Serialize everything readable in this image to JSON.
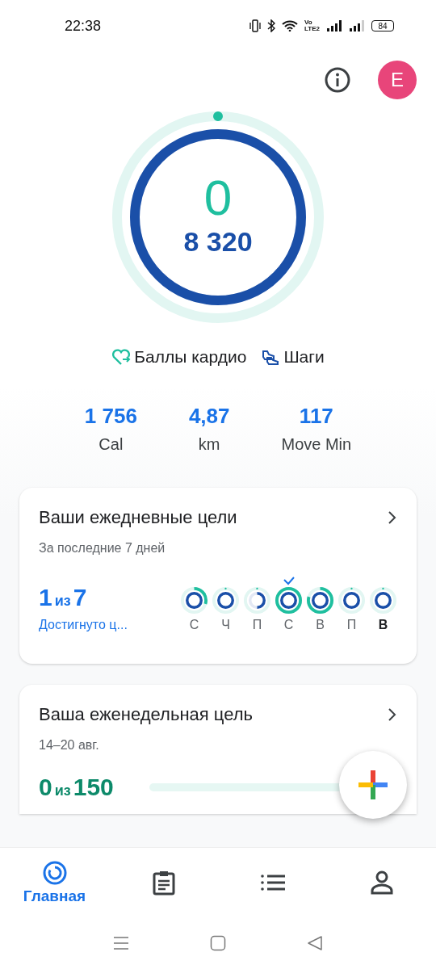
{
  "status_bar": {
    "time": "22:38",
    "volte": [
      "Vo",
      "LTE2"
    ],
    "battery": "84"
  },
  "header": {
    "avatar": "E"
  },
  "rings": {
    "cardio": {
      "value": "0",
      "level": 0
    },
    "steps": {
      "value": "8 320",
      "level": 1
    }
  },
  "legend": [
    {
      "kind": "cardio",
      "label": "Баллы кардио"
    },
    {
      "kind": "steps",
      "label": "Шаги"
    }
  ],
  "stats": [
    {
      "value": "1 756",
      "label": "Cal"
    },
    {
      "value": "4,87",
      "label": "km"
    },
    {
      "value": "117",
      "label": "Move Min"
    }
  ],
  "daily_card": {
    "title": "Ваши ежедневные цели",
    "subtitle": "За последние 7 дней",
    "count": "1",
    "of": "из",
    "total": "7",
    "caption": "Достигнуто ц...",
    "days": [
      {
        "label": "С",
        "cardio": {
          "level": 0.3
        },
        "steps": {
          "level": 1
        },
        "achieved": false,
        "today": false
      },
      {
        "label": "Ч",
        "cardio": {
          "level": 0
        },
        "steps": {
          "level": 1
        },
        "achieved": false,
        "today": false
      },
      {
        "label": "П",
        "cardio": {
          "level": 0
        },
        "steps": {
          "level": 0.5
        },
        "achieved": false,
        "today": false
      },
      {
        "label": "С",
        "cardio": {
          "level": 1
        },
        "steps": {
          "level": 1
        },
        "achieved": true,
        "today": false
      },
      {
        "label": "В",
        "cardio": {
          "level": 0.8
        },
        "steps": {
          "level": 1
        },
        "achieved": false,
        "today": false
      },
      {
        "label": "П",
        "cardio": {
          "level": 0
        },
        "steps": {
          "level": 1
        },
        "achieved": false,
        "today": false
      },
      {
        "label": "В",
        "cardio": {
          "level": 0
        },
        "steps": {
          "level": 1
        },
        "achieved": false,
        "today": true
      }
    ]
  },
  "weekly_card": {
    "title": "Ваша еженедельная цель",
    "subtitle": "14–20 авг.",
    "count": "0",
    "of": "из",
    "total": "150",
    "level": 0
  },
  "bottom_nav": [
    {
      "kind": "home",
      "label": "Главная",
      "selected": true
    },
    {
      "kind": "journal",
      "selected": false
    },
    {
      "kind": "browse",
      "selected": false
    },
    {
      "kind": "profile",
      "selected": false
    }
  ]
}
